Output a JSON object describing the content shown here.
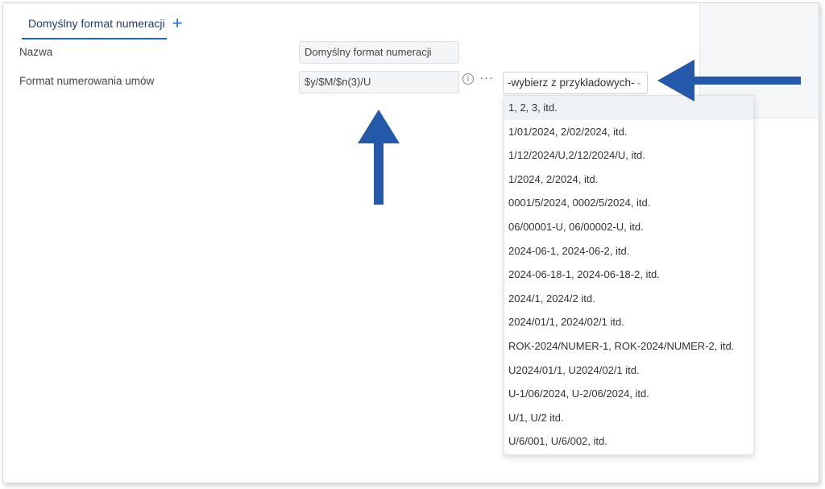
{
  "tabs": {
    "active_label": "Domyślny format numeracji",
    "add_icon": "plus-icon"
  },
  "form": {
    "name_label": "Nazwa",
    "name_value": "Domyślny format numeracji",
    "format_label": "Format numerowania umów",
    "format_value": "$y/$M/$n(3)/U",
    "info_icon": "info-icon",
    "more_icon": "more-icon"
  },
  "select": {
    "value": "-wybierz z przykładowych-",
    "chevron": "chevron-down-icon"
  },
  "dropdown": {
    "items": [
      "1, 2, 3, itd.",
      "1/01/2024, 2/02/2024, itd.",
      "1/12/2024/U,2/12/2024/U, itd.",
      "1/2024, 2/2024, itd.",
      "0001/5/2024, 0002/5/2024, itd.",
      "06/00001-U, 06/00002-U, itd.",
      "2024-06-1, 2024-06-2, itd.",
      "2024-06-18-1, 2024-06-18-2, itd.",
      "2024/1, 2024/2 itd.",
      "2024/01/1, 2024/02/1 itd.",
      "ROK-2024/NUMER-1, ROK-2024/NUMER-2, itd.",
      "U2024/01/1, U2024/02/1 itd.",
      "U-1/06/2024, U-2/06/2024, itd.",
      "U/1, U/2 itd.",
      "U/6/001, U/6/002, itd."
    ]
  },
  "annotations": {
    "arrow_color": "#2458a8"
  }
}
